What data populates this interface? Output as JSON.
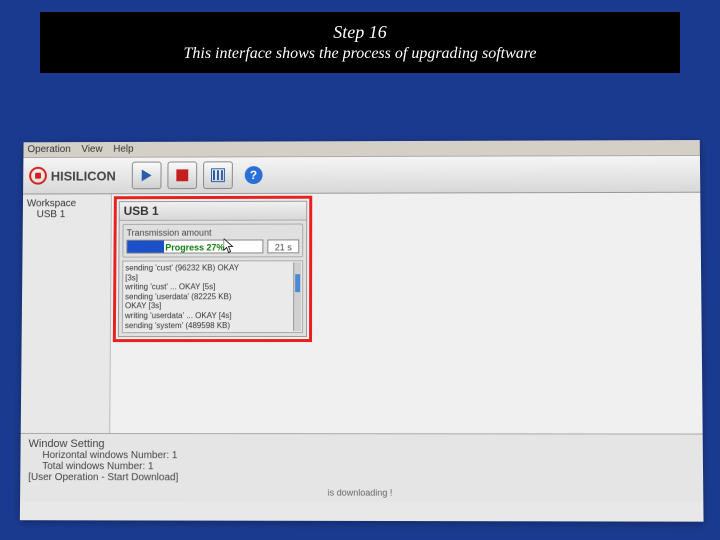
{
  "caption": {
    "title": "Step 16",
    "subtitle": "This interface shows the process of upgrading software"
  },
  "menubar": {
    "items": [
      "Operation",
      "View",
      "Help"
    ]
  },
  "logo_text": "HISILICON",
  "toolbar": {
    "play": "Play",
    "stop": "Stop",
    "config": "Config",
    "help_glyph": "?"
  },
  "sidebar": {
    "root": "Workspace",
    "child": "USB 1"
  },
  "usb_panel": {
    "title": "USB 1",
    "group_label": "Transmission amount",
    "progress_pct": 27,
    "progress_text": "Progress 27%",
    "elapsed": "21 s",
    "log_lines": [
      "sending 'cust' (96232 KB)    OKAY",
      "[3s]",
      "writing 'cust' ... OKAY [5s]",
      "sending 'userdata' (82225 KB)",
      "OKAY [3s]",
      "writing 'userdata' ... OKAY [4s]",
      "sending 'system' (489598 KB)"
    ]
  },
  "bottom": {
    "title": "Window Setting",
    "line1": "Horizontal windows Number: 1",
    "line2": "Total windows Number: 1",
    "op_line": "[User Operation - Start Download]",
    "status": "is downloading !"
  }
}
